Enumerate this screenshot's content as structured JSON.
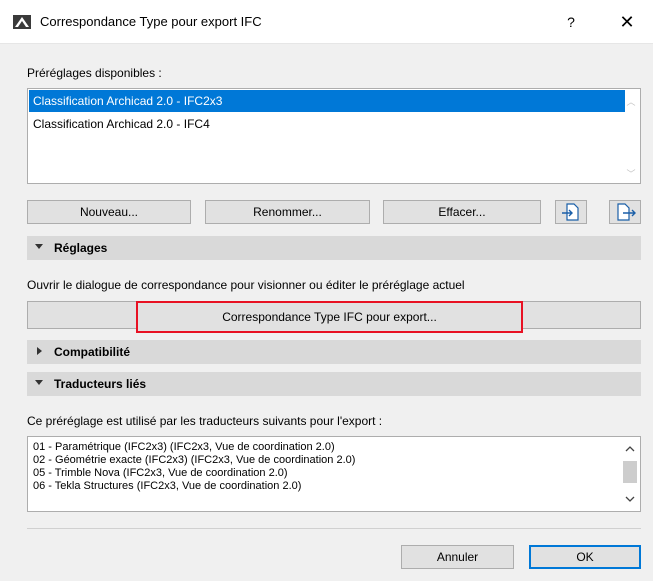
{
  "window": {
    "title": "Correspondance Type pour export IFC",
    "help": "?",
    "close": "✕"
  },
  "presets": {
    "label": "Préréglages disponibles :",
    "items": [
      "Classification Archicad 2.0 - IFC2x3",
      "Classification Archicad 2.0 - IFC4"
    ],
    "selected_index": 0
  },
  "buttons": {
    "new": "Nouveau...",
    "rename": "Renommer...",
    "delete": "Effacer..."
  },
  "settings": {
    "header": "Réglages",
    "description": "Ouvrir le dialogue de correspondance pour visionner ou éditer le préréglage actuel",
    "mapping_button": "Correspondance Type IFC pour export..."
  },
  "compatibility": {
    "header": "Compatibilité"
  },
  "linked": {
    "header": "Traducteurs liés",
    "description": "Ce préréglage est utilisé par les traducteurs suivants pour l'export :",
    "items": [
      "01 - Paramétrique (IFC2x3) (IFC2x3, Vue de coordination 2.0)",
      "02 - Géométrie exacte (IFC2x3) (IFC2x3, Vue de coordination 2.0)",
      "05 - Trimble Nova (IFC2x3, Vue de coordination 2.0)",
      "06 - Tekla Structures (IFC2x3, Vue de coordination 2.0)"
    ]
  },
  "footer": {
    "cancel": "Annuler",
    "ok": "OK"
  },
  "colors": {
    "selection": "#0078d7",
    "highlight_frame": "#e81123"
  },
  "icons": [
    "archicad-app-icon",
    "import-icon",
    "export-icon",
    "collapse-triangle-icon",
    "expand-triangle-icon"
  ]
}
